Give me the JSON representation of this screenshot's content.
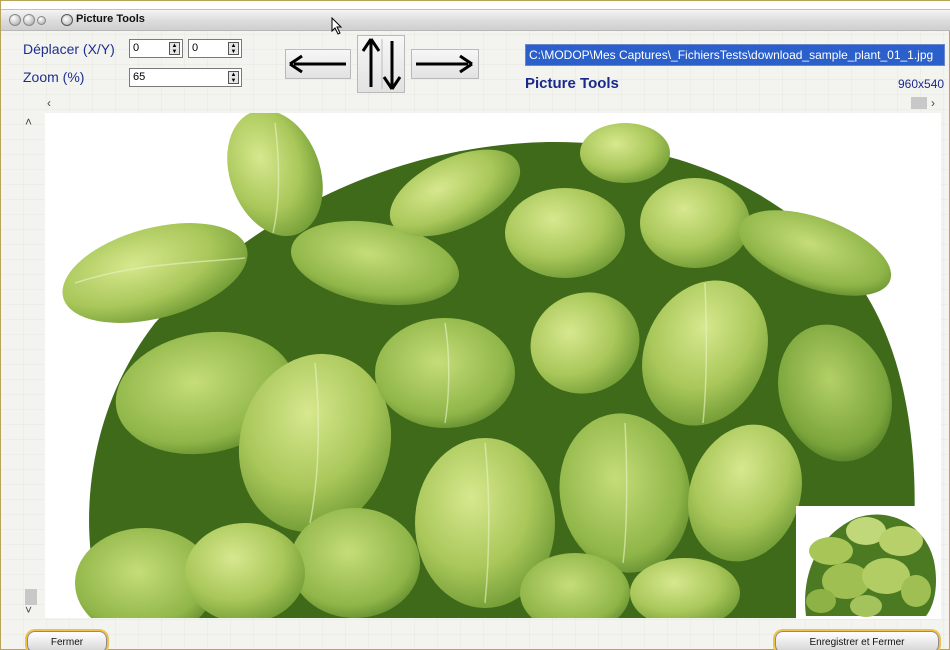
{
  "window": {
    "title": "Picture Tools"
  },
  "controls": {
    "move_label": "Déplacer (X/Y)",
    "move_x": "0",
    "move_y": "0",
    "zoom_label": "Zoom (%)",
    "zoom_value": "65"
  },
  "file": {
    "path": "C:\\MODOP\\Mes Captures\\_FichiersTests\\download_sample_plant_01_1.jpg",
    "app_title": "Picture Tools",
    "dimensions": "960x540"
  },
  "scroll": {
    "left": "‹",
    "right": "›",
    "up": "˄",
    "down": "˅"
  },
  "buttons": {
    "close": "Fermer",
    "save_close": "Enregistrer et Fermer"
  },
  "icons": {
    "left": "arrow-left-icon",
    "up_down": "arrow-up-down-icon",
    "right": "arrow-right-icon"
  },
  "colors": {
    "accent": "#f2b526",
    "label": "#1f2f8f",
    "selection": "#2b5fc9",
    "leaf_light": "#b9d46a",
    "leaf_dark": "#5f8a2c"
  }
}
